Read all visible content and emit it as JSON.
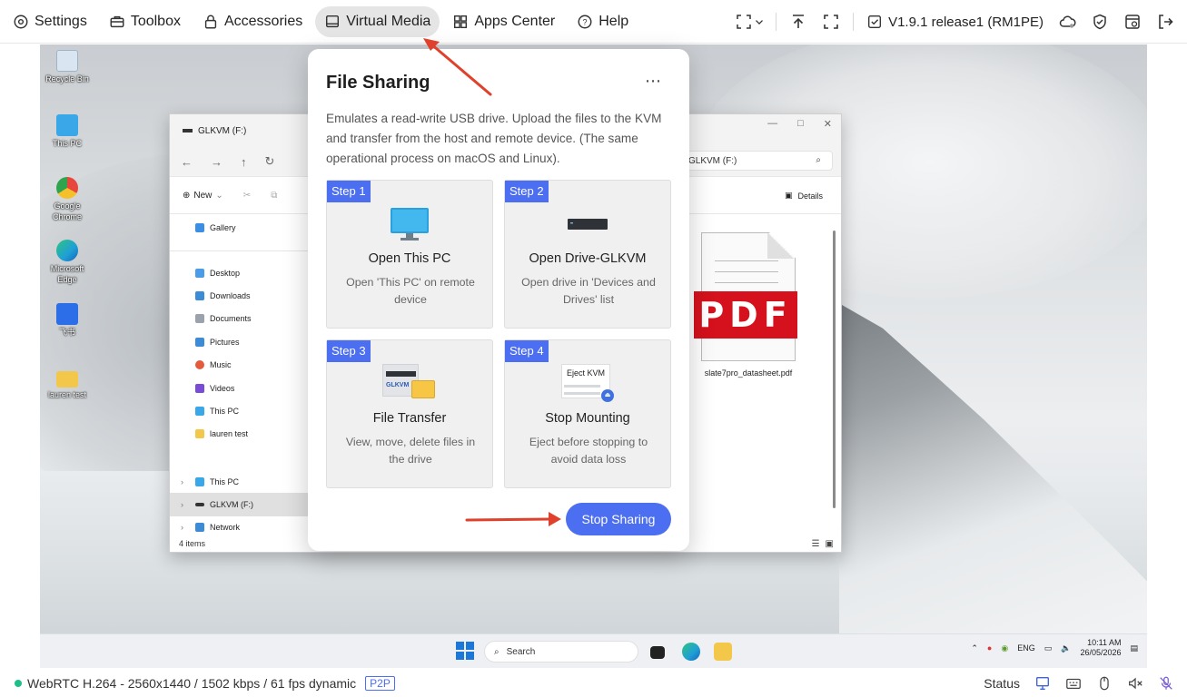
{
  "topbar": {
    "tabs": [
      {
        "label": "Settings",
        "icon": "gear-icon"
      },
      {
        "label": "Toolbox",
        "icon": "toolbox-icon"
      },
      {
        "label": "Accessories",
        "icon": "lock-icon"
      },
      {
        "label": "Virtual Media",
        "icon": "monitor-icon",
        "active": true
      },
      {
        "label": "Apps Center",
        "icon": "grid-icon"
      },
      {
        "label": "Help",
        "icon": "help-icon"
      }
    ],
    "version": "V1.9.1 release1 (RM1PE)"
  },
  "desktop": {
    "icons": [
      {
        "label": "Recycle Bin",
        "color": "#d9e6f2"
      },
      {
        "label": "This PC",
        "color": "#3aa7e8"
      },
      {
        "label": "Google Chrome",
        "color": "#e8453c"
      },
      {
        "label": "Microsoft Edge",
        "color": "#1f9fd6"
      },
      {
        "label": "飞书",
        "color": "#2c6ee8"
      },
      {
        "label": "lauren test",
        "color": "#f3c74a"
      }
    ]
  },
  "explorer": {
    "title": "GLKVM (F:)",
    "address": "GLKVM (F:)",
    "new_label": "New",
    "details_label": "Details",
    "sidebar": [
      {
        "label": "Gallery",
        "color": "#3a8ee6"
      },
      {
        "label": "Desktop",
        "color": "#4a9be8"
      },
      {
        "label": "Downloads",
        "color": "#3c8bd6"
      },
      {
        "label": "Documents",
        "color": "#9aa3ad"
      },
      {
        "label": "Pictures",
        "color": "#3c8bd6"
      },
      {
        "label": "Music",
        "color": "#e55a3c"
      },
      {
        "label": "Videos",
        "color": "#7a4bd6"
      },
      {
        "label": "This PC",
        "color": "#3aa7e8"
      },
      {
        "label": "lauren test",
        "color": "#f3c74a"
      },
      {
        "label": "This PC",
        "color": "#3aa7e8"
      },
      {
        "label": "GLKVM (F:)",
        "color": "#333333"
      },
      {
        "label": "Network",
        "color": "#3c8bd6"
      }
    ],
    "status": "4 items",
    "file": {
      "name": "slate7pro_datasheet.pdf",
      "badge": "PDF"
    }
  },
  "taskbar": {
    "search_placeholder": "Search",
    "lang": "ENG",
    "time": "10:11 AM",
    "date": "26/05/2026"
  },
  "card": {
    "title": "File Sharing",
    "menu": "⋯",
    "description": "Emulates a read-write USB drive. Upload the files to the KVM and transfer from the host and remote device. (The same operational process on macOS and Linux).",
    "steps": [
      {
        "badge": "Step 1",
        "title": "Open This PC",
        "desc": "Open 'This PC' on remote device"
      },
      {
        "badge": "Step 2",
        "title": "Open Drive-GLKVM",
        "desc": "Open drive in 'Devices and Drives' list"
      },
      {
        "badge": "Step 3",
        "title": "File Transfer",
        "desc": "View, move, delete files in the drive",
        "art_label": "GLKVM"
      },
      {
        "badge": "Step 4",
        "title": "Stop Mounting",
        "desc": "Eject before stopping to avoid data loss",
        "art_label": "Eject KVM"
      }
    ],
    "stop_button": "Stop Sharing",
    "accent": "#4c6ef0"
  },
  "statusbar": {
    "stream": "WebRTC H.264 - 2560x1440 / 1502 kbps / 61 fps dynamic",
    "p2p": "P2P",
    "status_label": "Status"
  }
}
